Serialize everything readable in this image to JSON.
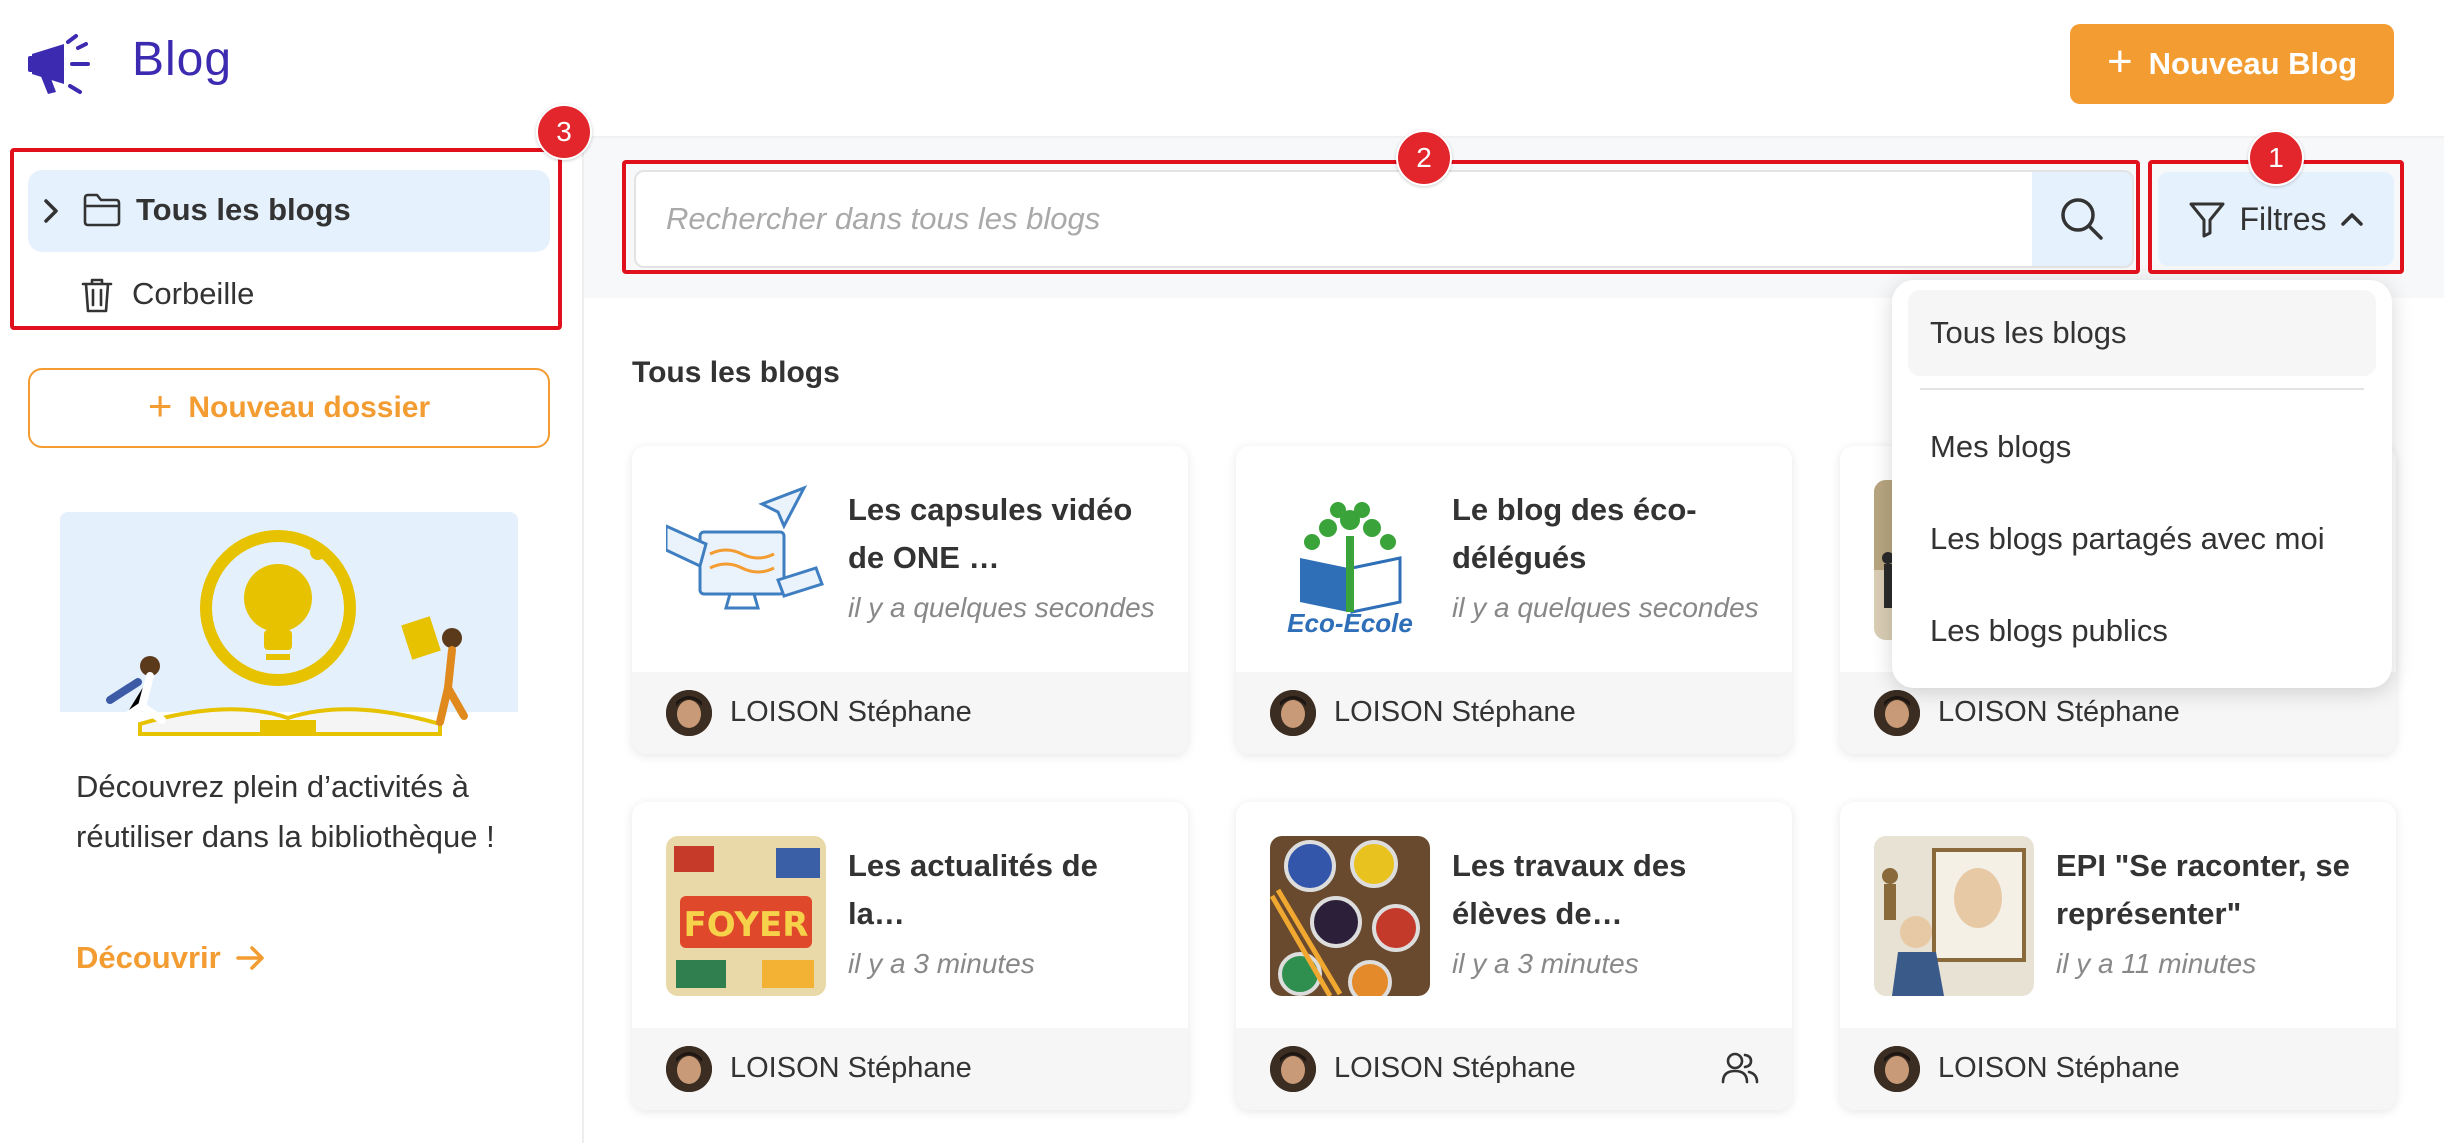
{
  "app": {
    "title": "Blog",
    "logo_icon": "megaphone-icon"
  },
  "header": {
    "new_blog_label": "Nouveau Blog"
  },
  "sidebar": {
    "items": [
      {
        "label": "Tous les blogs",
        "icon": "folder-icon",
        "active": true
      },
      {
        "label": "Corbeille",
        "icon": "trash-icon"
      }
    ],
    "new_folder_label": "Nouveau dossier",
    "promo": {
      "text": "Découvrez plein d’activités à réutiliser dans la bibliothèque !",
      "link_label": "Découvrir"
    }
  },
  "search": {
    "placeholder": "Rechercher dans tous les blogs",
    "value": ""
  },
  "filters": {
    "label": "Filtres",
    "options": [
      "Tous les blogs",
      "Mes blogs",
      "Les blogs partagés avec moi",
      "Les blogs publics"
    ],
    "selected": "Tous les blogs"
  },
  "main": {
    "section_title": "Tous les blogs",
    "cards": [
      {
        "title": "Les capsules vidéo de ONE …",
        "time": "il y a quelques secondes",
        "author": "LOISON Stéphane",
        "shared": false
      },
      {
        "title": "Le blog des éco-délégués",
        "time": "il y a quelques secondes",
        "author": "LOISON Stéphane",
        "shared": false
      },
      {
        "title": "",
        "time": "",
        "author": "LOISON Stéphane",
        "shared": false
      },
      {
        "title": "Les actualités de la…",
        "time": "il y a 3 minutes",
        "author": "LOISON Stéphane",
        "shared": false
      },
      {
        "title": "Les travaux des élèves de…",
        "time": "il y a 3 minutes",
        "author": "LOISON Stéphane",
        "shared": true
      },
      {
        "title": "EPI \"Se raconter, se représenter\"",
        "time": "il y a 11 minutes",
        "author": "LOISON Stéphane",
        "shared": false
      }
    ]
  },
  "eco_logo_text": "Eco-Ecole",
  "annotations": [
    "1",
    "2",
    "3"
  ],
  "colors": {
    "accent": "#f39c32",
    "brand": "#3c2bb0",
    "highlight": "#e5f1fc",
    "annotation": "#e0101c"
  }
}
